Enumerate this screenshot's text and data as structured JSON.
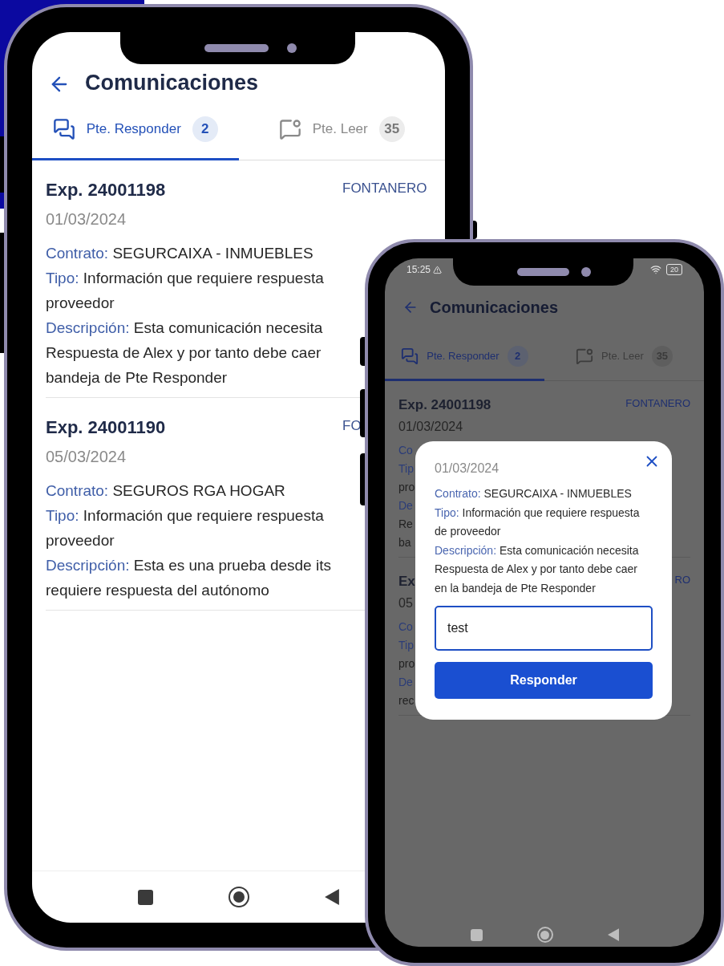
{
  "main_phone": {
    "header": {
      "title": "Comunicaciones"
    },
    "tabs": [
      {
        "kind": "respond",
        "label": "Pte. Responder",
        "count": "2",
        "selected": true
      },
      {
        "kind": "read",
        "label": "Pte. Leer",
        "count": "35",
        "selected": false
      }
    ],
    "items": [
      {
        "title": "Exp. 24001198",
        "category": "FONTANERO",
        "date": "01/03/2024",
        "lines": [
          {
            "label": "Contrato:",
            "text": "SEGURCAIXA - INMUEBLES"
          },
          {
            "label": "Tipo:",
            "text": "Información que requiere respuesta"
          },
          {
            "text": "proveedor"
          },
          {
            "label": "Descripción:",
            "text": "Esta comunicación necesita"
          },
          {
            "text": "Respuesta de Alex y por tanto debe caer"
          },
          {
            "text": "bandeja de Pte Responder"
          }
        ]
      },
      {
        "title": "Exp. 24001190",
        "category": "FO",
        "date": "05/03/2024",
        "lines": [
          {
            "label": "Contrato:",
            "text": "SEGUROS RGA HOGAR"
          },
          {
            "label": "Tipo:",
            "text": "Información que requiere respuesta"
          },
          {
            "text": "proveedor"
          },
          {
            "label": "Descripción:",
            "text": "Esta es una prueba desde its"
          },
          {
            "text": "requiere respuesta del autónomo"
          }
        ]
      }
    ]
  },
  "second_phone": {
    "status_bar": {
      "time": "15:25",
      "battery": "20"
    },
    "header": {
      "title": "Comunicaciones"
    },
    "tabs": [
      {
        "kind": "respond",
        "label": "Pte. Responder",
        "count": "2",
        "selected": true
      },
      {
        "kind": "read",
        "label": "Pte. Leer",
        "count": "35",
        "selected": false
      }
    ],
    "items": [
      {
        "title": "Exp. 24001198",
        "category": "FONTANERO",
        "date": "01/03/2024",
        "lines": [
          {
            "label": "Co"
          },
          {
            "label": "Tip"
          },
          {
            "text": "pro"
          },
          {
            "label": "De"
          },
          {
            "text": "Re"
          },
          {
            "text": "ba"
          }
        ]
      },
      {
        "title": "Ex",
        "category": "RO",
        "date": "05",
        "lines": [
          {
            "label": "Co"
          },
          {
            "label": "Tip"
          },
          {
            "text": "pro"
          },
          {
            "label": "De"
          },
          {
            "text": "rec"
          }
        ]
      }
    ],
    "dialog": {
      "date": "01/03/2024",
      "fields": [
        {
          "label": "Contrato:",
          "text": "SEGURCAIXA - INMUEBLES"
        },
        {
          "label": "Tipo:",
          "text": "Información que requiere respuesta de proveedor"
        },
        {
          "label": "Descripción:",
          "text": "Esta comunicación necesita Respuesta de Alex y por tanto debe caer en la bandeja de Pte Responder"
        }
      ],
      "reply_value": "test",
      "button": "Responder"
    }
  }
}
